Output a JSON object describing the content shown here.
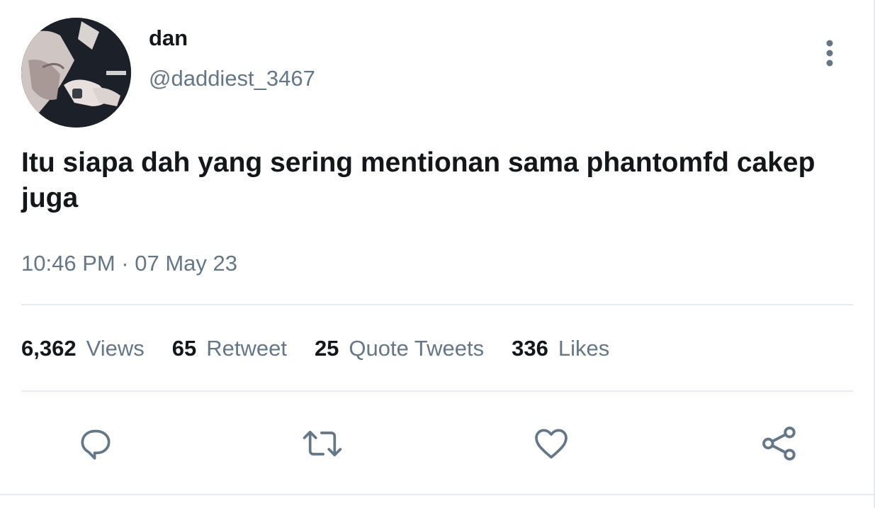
{
  "author": {
    "display_name": "dan",
    "handle": "@daddiest_3467",
    "avatar_icon": "profile-photo"
  },
  "tweet": {
    "text": "Itu siapa dah yang sering mentionan sama phantomfd cakep juga",
    "timestamp": "10:46 PM · 07 May 23"
  },
  "stats": [
    {
      "count": "6,362",
      "label": "Views"
    },
    {
      "count": "65",
      "label": "Retweet"
    },
    {
      "count": "25",
      "label": "Quote Tweets"
    },
    {
      "count": "336",
      "label": "Likes"
    }
  ],
  "actions": {
    "reply_icon": "reply-icon",
    "retweet_icon": "retweet-icon",
    "like_icon": "heart-icon",
    "share_icon": "share-icon"
  },
  "menu_icon": "more-vertical-icon",
  "colors": {
    "text_primary": "#14171a",
    "text_secondary": "#657786",
    "divider": "#e6ecf0",
    "icon": "#657786"
  }
}
